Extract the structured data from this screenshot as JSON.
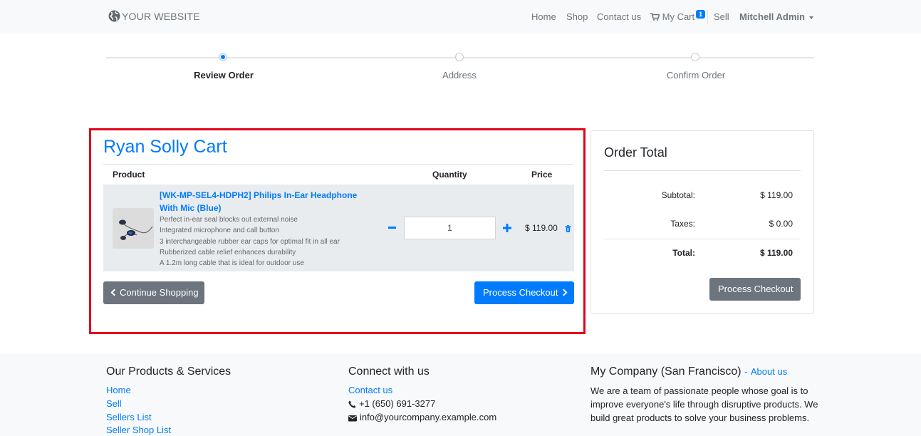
{
  "header": {
    "logo_text": "YOUR WEBSITE",
    "nav": {
      "home": "Home",
      "shop": "Shop",
      "contact": "Contact us",
      "cart": "My Cart",
      "cart_count": "1",
      "sell": "Sell",
      "user": "Mitchell Admin"
    }
  },
  "steps": [
    {
      "label": "Review Order",
      "active": true
    },
    {
      "label": "Address",
      "active": false
    },
    {
      "label": "Confirm Order",
      "active": false
    }
  ],
  "cart": {
    "title": "Ryan Solly Cart",
    "columns": {
      "product": "Product",
      "quantity": "Quantity",
      "price": "Price"
    },
    "item": {
      "name": "[WK-MP-SEL4-HDPH2] Philips In-Ear Headphone With Mic (Blue)",
      "description": [
        "Perfect in-ear seal blocks out external noise",
        "Integrated microphone and call button",
        "3 interchangeable rubber ear caps for optimal fit in all ear",
        "Rubberized cable relief enhances durability",
        "A 1.2m long cable that is ideal for outdoor use"
      ],
      "quantity": "1",
      "price": "$ 119.00",
      "thumbnail_icon": "headphone-image"
    },
    "continue_label": "Continue Shopping",
    "checkout_label": "Process Checkout"
  },
  "order_total": {
    "title": "Order Total",
    "subtotal_label": "Subtotal:",
    "subtotal": "$ 119.00",
    "taxes_label": "Taxes:",
    "taxes": "$ 0.00",
    "total_label": "Total:",
    "total": "$ 119.00",
    "checkout_label": "Process Checkout"
  },
  "footer": {
    "products_title": "Our Products & Services",
    "products_links": [
      "Home",
      "Sell",
      "Sellers List",
      "Seller Shop List"
    ],
    "connect_title": "Connect with us",
    "contact_link": "Contact us",
    "phone": "+1 (650) 691-3277",
    "email": "info@yourcompany.example.com",
    "company_title": "My Company (San Francisco)",
    "about_link": "About us",
    "about_text": "We are a team of passionate people whose goal is to improve everyone's life through disruptive products. We build great products to solve your business problems."
  },
  "colors": {
    "accent": "#007bff",
    "secondary": "#6c757d",
    "highlight_border": "#e3001b"
  }
}
